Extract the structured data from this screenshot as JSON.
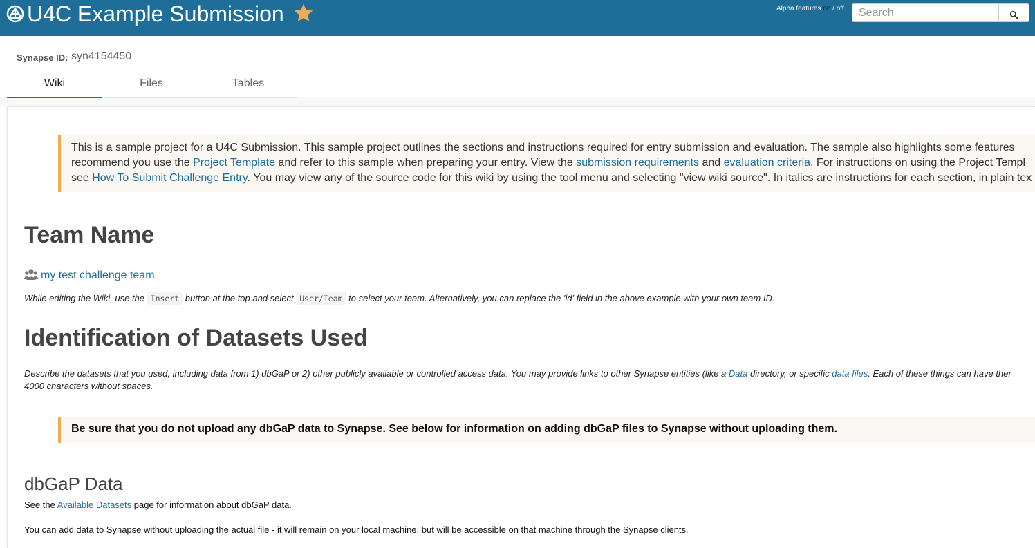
{
  "header": {
    "title": "U4C Example Submission",
    "alpha_prefix": "Alpha features ",
    "alpha_on": "on",
    "alpha_sep": " / off",
    "search_placeholder": "Search"
  },
  "meta": {
    "synapse_id_label": "Synapse ID:",
    "synapse_id_value": "syn4154450"
  },
  "tabs": [
    {
      "label": "Wiki",
      "active": true
    },
    {
      "label": "Files",
      "active": false
    },
    {
      "label": "Tables",
      "active": false
    }
  ],
  "content": {
    "intro": {
      "l1": "This is a sample project for a U4C Submission. This sample project outlines the sections and instructions required for entry submission and evaluation. The sample also highlights some features",
      "l2_a": "recommend you use the ",
      "l2_link1": "Project Template",
      "l2_b": " and refer to this sample when preparing your entry. View the ",
      "l2_link2": "submission requirements",
      "l2_c": " and ",
      "l2_link3": "evaluation criteria",
      "l2_d": ". For instructions on using the Project Templ",
      "l3_a": "see ",
      "l3_link": "How To Submit Challenge Entry",
      "l3_b": ". You may view any of the source code for this wiki by using the tool menu and selecting \"view wiki source\". In italics are instructions for each section, in plain tex"
    },
    "team_heading": "Team Name",
    "team_link": "my test challenge team",
    "edit_note": {
      "a": "While editing the Wiki, use the ",
      "code1": "Insert",
      "b": " button at the top and select ",
      "code2": "User/Team",
      "c": " to select your team. Alternatively, you can replace the 'id' field in the above example with your own team ID."
    },
    "datasets_heading": "Identification of Datasets Used",
    "datasets_desc": {
      "a": "Describe the datasets that you used, including data from 1) dbGaP or 2) other publicly available or controlled access data. You may provide links to other Synapse entities (like a ",
      "link1": "Data",
      "b": " directory, or specific ",
      "link2": "data files",
      "c": ". Each of these things can have ther",
      "line2": "4000 characters without spaces."
    },
    "warning": "Be sure that you do not upload any dbGaP data to Synapse. See below for information on adding dbGaP files to Synapse without uploading them.",
    "dbgap_heading": "dbGaP Data",
    "dbgap_avail": {
      "a": "See the ",
      "link": "Available Datasets",
      "b": " page for information about dbGaP data."
    },
    "dbgap_add": "You can add data to Synapse without uploading the actual file - it will remain on your local machine, but will be accessible on that machine through the Synapse clients."
  },
  "colors": {
    "header_bg": "#1e6e99",
    "link": "#1e6e99",
    "star": "#f0ad4e",
    "callout_border": "#f0ad4e"
  },
  "icons": [
    "synapse-logo-icon",
    "star-icon",
    "search-icon",
    "users-icon"
  ]
}
